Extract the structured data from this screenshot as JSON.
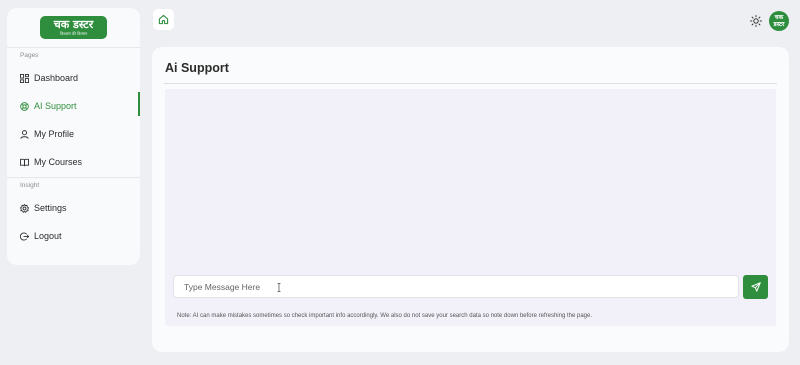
{
  "brand": {
    "logo_text": "चक डस्टर",
    "logo_tagline": "विश्वास की किसान"
  },
  "avatar": {
    "text": "चक डस्टर"
  },
  "sidebar": {
    "sections": [
      {
        "label": "Pages",
        "items": [
          {
            "label": "Dashboard",
            "icon": "grid-icon",
            "active": false
          },
          {
            "label": "AI Support",
            "icon": "support-icon",
            "active": true
          },
          {
            "label": "My Profile",
            "icon": "user-icon",
            "active": false
          },
          {
            "label": "My Courses",
            "icon": "book-icon",
            "active": false
          }
        ]
      },
      {
        "label": "Insight",
        "items": [
          {
            "label": "Settings",
            "icon": "gear-icon",
            "active": false
          },
          {
            "label": "Logout",
            "icon": "logout-icon",
            "active": false
          }
        ]
      }
    ]
  },
  "header": {
    "home_icon": "home-icon",
    "theme_icon": "sun-icon"
  },
  "main": {
    "title": "Ai Support",
    "input_placeholder": "Type Message Here",
    "send_icon": "send-icon",
    "note": "Note: AI can make mistakes sometimes so check important info accordingly. We also do not save your search data so note down before refreshing the page."
  },
  "colors": {
    "accent": "#2f8e3e",
    "background": "#eeeff2",
    "chat_bg": "#f2f1fa"
  }
}
